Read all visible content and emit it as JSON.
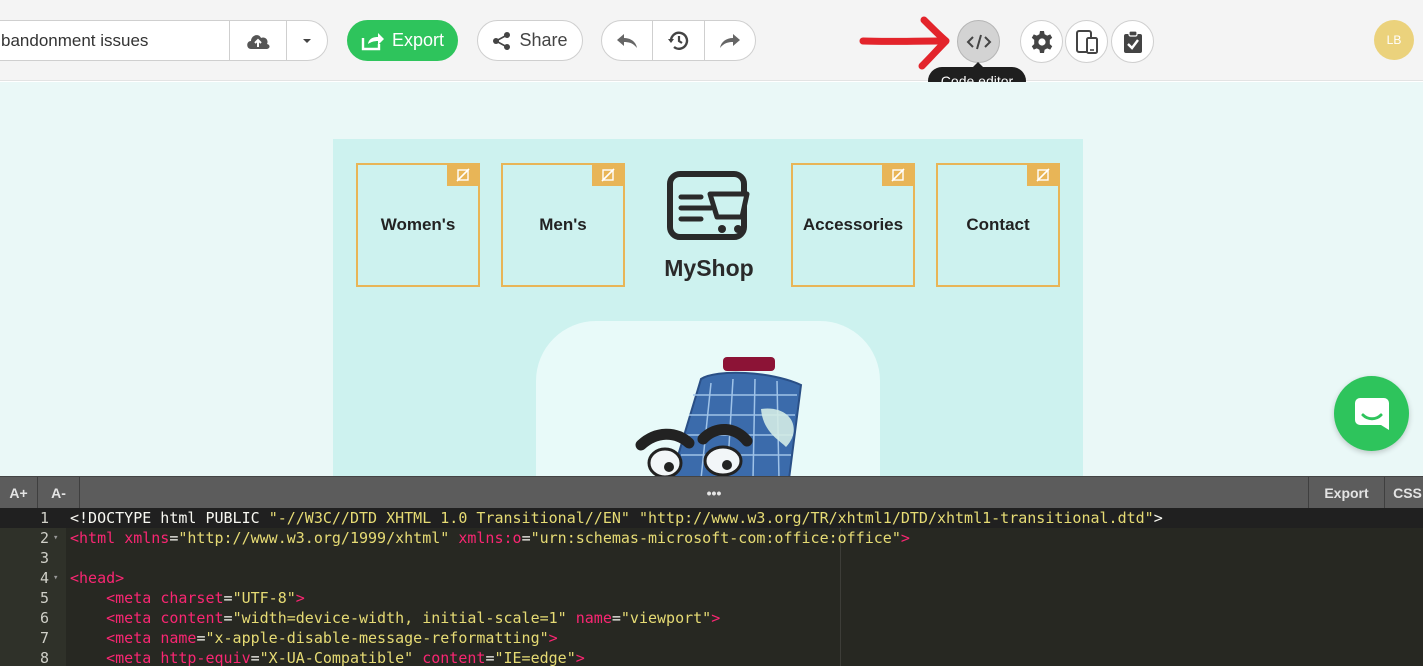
{
  "toolbar": {
    "template_name": "bandonment issues",
    "export_label": "Export",
    "share_label": "Share",
    "tooltip": "Code editor",
    "avatar_initials": "LB"
  },
  "email": {
    "nav": [
      "Women's",
      "Men's",
      "Accessories",
      "Contact"
    ],
    "logo_text": "MyShop"
  },
  "editor_toolbar": {
    "font_increase": "A+",
    "font_decrease": "A-",
    "handle": "•••",
    "export": "Export",
    "css": "CSS"
  },
  "code_lines": [
    {
      "n": "1",
      "fold": "",
      "parts": [
        [
          "txt",
          "<!DOCTYPE html PUBLIC "
        ],
        [
          "val",
          "\"-//W3C//DTD XHTML 1.0 Transitional//EN\""
        ],
        [
          "txt",
          " "
        ],
        [
          "val",
          "\"http://www.w3.org/TR/xhtml1/DTD/xhtml1-transitional.dtd\""
        ],
        [
          "txt",
          ">"
        ]
      ]
    },
    {
      "n": "2",
      "fold": "▾",
      "parts": [
        [
          "tag",
          "<html "
        ],
        [
          "attr",
          "xmlns"
        ],
        [
          "txt",
          "="
        ],
        [
          "val",
          "\"http://www.w3.org/1999/xhtml\""
        ],
        [
          "txt",
          " "
        ],
        [
          "attr",
          "xmlns:o"
        ],
        [
          "txt",
          "="
        ],
        [
          "val",
          "\"urn:schemas-microsoft-com:office:office\""
        ],
        [
          "tag",
          ">"
        ]
      ]
    },
    {
      "n": "3",
      "fold": "",
      "parts": []
    },
    {
      "n": "4",
      "fold": "▾",
      "parts": [
        [
          "tag",
          "<head>"
        ]
      ]
    },
    {
      "n": "5",
      "fold": "",
      "parts": [
        [
          "txt",
          "    "
        ],
        [
          "tag",
          "<meta "
        ],
        [
          "attr",
          "charset"
        ],
        [
          "txt",
          "="
        ],
        [
          "val",
          "\"UTF-8\""
        ],
        [
          "tag",
          ">"
        ]
      ]
    },
    {
      "n": "6",
      "fold": "",
      "parts": [
        [
          "txt",
          "    "
        ],
        [
          "tag",
          "<meta "
        ],
        [
          "attr",
          "content"
        ],
        [
          "txt",
          "="
        ],
        [
          "val",
          "\"width=device-width, initial-scale=1\""
        ],
        [
          "txt",
          " "
        ],
        [
          "attr",
          "name"
        ],
        [
          "txt",
          "="
        ],
        [
          "val",
          "\"viewport\""
        ],
        [
          "tag",
          ">"
        ]
      ]
    },
    {
      "n": "7",
      "fold": "",
      "parts": [
        [
          "txt",
          "    "
        ],
        [
          "tag",
          "<meta "
        ],
        [
          "attr",
          "name"
        ],
        [
          "txt",
          "="
        ],
        [
          "val",
          "\"x-apple-disable-message-reformatting\""
        ],
        [
          "tag",
          ">"
        ]
      ]
    },
    {
      "n": "8",
      "fold": "",
      "parts": [
        [
          "txt",
          "    "
        ],
        [
          "tag",
          "<meta "
        ],
        [
          "attr",
          "http-equiv"
        ],
        [
          "txt",
          "="
        ],
        [
          "val",
          "\"X-UA-Compatible\""
        ],
        [
          "txt",
          " "
        ],
        [
          "attr",
          "content"
        ],
        [
          "txt",
          "="
        ],
        [
          "val",
          "\"IE=edge\""
        ],
        [
          "tag",
          ">"
        ]
      ]
    }
  ],
  "colors": {
    "accent_green": "#2ec45c",
    "arrow_red": "#e3242b",
    "nav_border": "#e8b557",
    "avatar": "#ebd27c"
  }
}
